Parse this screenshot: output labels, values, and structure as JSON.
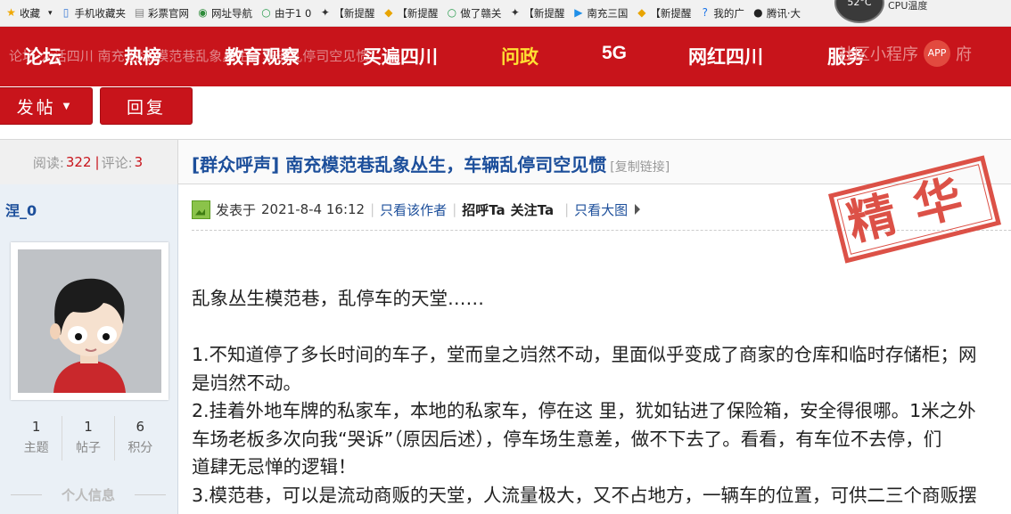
{
  "bookmarks": [
    {
      "icon": "star-icon",
      "label": "收藏",
      "caret": "▾"
    },
    {
      "icon": "phone-icon",
      "label": "手机收藏夹"
    },
    {
      "icon": "doc-icon",
      "label": "彩票官网"
    },
    {
      "icon": "compass-icon",
      "label": "网址导航"
    },
    {
      "icon": "circle-icon",
      "label": "由于1 0"
    },
    {
      "icon": "brand-icon",
      "label": "【新提醒"
    },
    {
      "icon": "medal-icon",
      "label": "【新提醒"
    },
    {
      "icon": "circle-icon",
      "label": "做了赣关"
    },
    {
      "icon": "brand-icon",
      "label": "【新提醒"
    },
    {
      "icon": "play-icon",
      "label": "南充三国"
    },
    {
      "icon": "medal-icon",
      "label": "【新提醒"
    },
    {
      "icon": "question-icon",
      "label": "我的广"
    },
    {
      "icon": "penguin-icon",
      "label": "腾讯·大"
    }
  ],
  "cpu": {
    "label": "CPU温度",
    "value": "52°C"
  },
  "nav": {
    "ghost_text": "论坛 大话四川 南充论坛 模范巷乱象丛生，车辆乱停司空见惯",
    "items": [
      "论坛",
      "热榜",
      "教育观察",
      "买遍四川",
      "问政",
      "5G",
      "网红四川",
      "服务"
    ],
    "active": "问政",
    "mini_program": "社区小程序",
    "app_badge": "APP",
    "app_text": "府"
  },
  "actions": {
    "post": "发帖",
    "reply": "回复"
  },
  "thread": {
    "reads_label": "阅读:",
    "reads": "322",
    "comments_label": "评论:",
    "comments": "3",
    "title": "[群众呼声] 南充模范巷乱象丛生，车辆乱停司空见惯",
    "copy_link": "[复制链接]"
  },
  "author": {
    "name": "涅_0",
    "stats": [
      {
        "value": "1",
        "label": "主题"
      },
      {
        "value": "1",
        "label": "帖子"
      },
      {
        "value": "6",
        "label": "积分"
      }
    ],
    "profile_heading": "个人信息"
  },
  "post": {
    "posted_label": "发表于",
    "datetime": "2021-8-4 16:12",
    "only_author": "只看该作者",
    "greet": "招呼Ta",
    "follow": "关注Ta",
    "big_image": "只看大图",
    "stamp": "精华",
    "lines": [
      "乱象丛生模范巷，乱停车的天堂……",
      "",
      "1.不知道停了多长时间的车子，堂而皇之岿然不动，里面似乎变成了商家的仓库和临时存储柜；网",
      "是岿然不动。",
      "2.挂着外地车牌的私家车，本地的私家车，停在这 里，犹如钻进了保险箱，安全得很哪。1米之外",
      "车场老板多次向我“哭诉”（原因后述），停车场生意差，做不下去了。看看，有车位不去停，们",
      "道肆无忌惮的逻辑！",
      "3.模范巷，可以是流动商贩的天堂，人流量极大，又不占地方，一辆车的位置，可供二三个商贩摆"
    ]
  }
}
